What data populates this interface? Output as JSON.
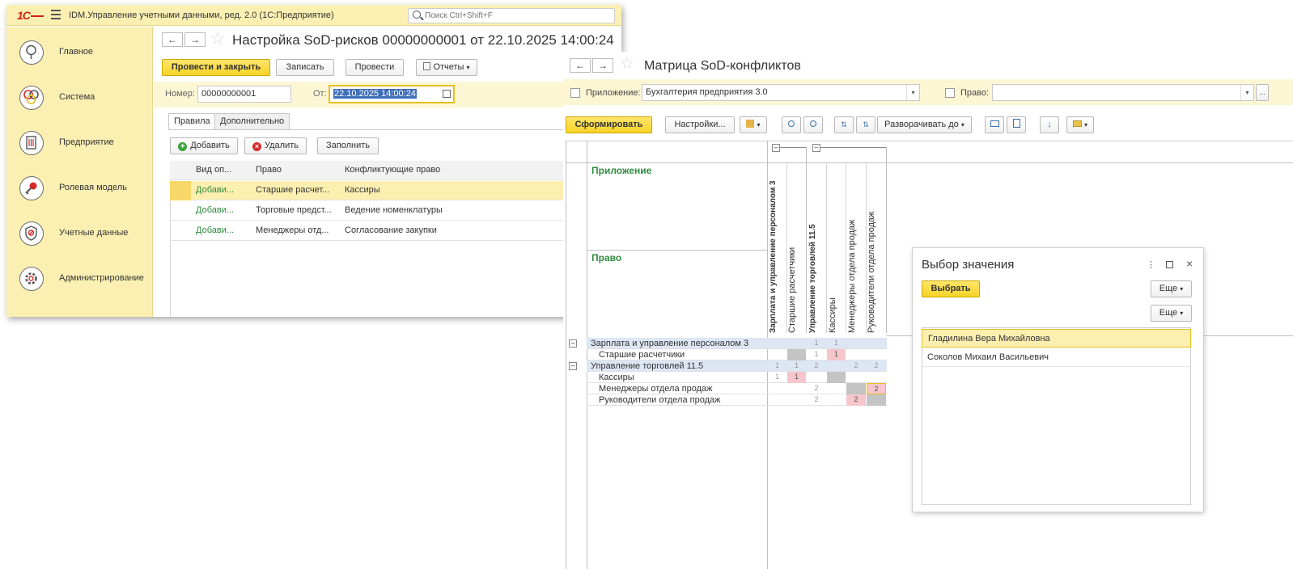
{
  "window1": {
    "app_title": "IDM.Управление учетными данными, ред. 2.0  (1С:Предприятие)",
    "search": {
      "placeholder": "Поиск Ctrl+Shift+F"
    },
    "sidebar": {
      "items": [
        {
          "label": "Главное",
          "icon": "tree-icon"
        },
        {
          "label": "Система",
          "icon": "system-icon"
        },
        {
          "label": "Предприятие",
          "icon": "building-icon"
        },
        {
          "label": "Ролевая модель",
          "icon": "key-icon"
        },
        {
          "label": "Учетные данные",
          "icon": "shield-icon"
        },
        {
          "label": "Администрирование",
          "icon": "gear-icon"
        }
      ]
    },
    "document": {
      "title": "Настройка SoD-рисков 00000000001 от 22.10.2025 14:00:24",
      "toolbar": {
        "post_close": "Провести и закрыть",
        "save": "Записать",
        "post": "Провести",
        "reports": "Отчеты"
      },
      "number_label": "Номер:",
      "number_value": "00000000001",
      "date_label": "От:",
      "date_value": "22.10.2025 14:00:24",
      "tabs": [
        "Правила",
        "Дополнительно"
      ],
      "table_toolbar": {
        "add": "Добавить",
        "delete": "Удалить",
        "fill": "Заполнить"
      },
      "table": {
        "columns": [
          "Вид оп...",
          "Право",
          "Конфликтующие право"
        ],
        "rows": [
          {
            "op": "Добави...",
            "right": "Старшие расчет...",
            "conflict": "Кассиры"
          },
          {
            "op": "Добави...",
            "right": "Торговые предст...",
            "conflict": "Ведение номенклатуры"
          },
          {
            "op": "Добави...",
            "right": "Менеджеры отд...",
            "conflict": "Согласование закупки"
          }
        ]
      }
    }
  },
  "window2": {
    "title": "Матрица SoD-конфликтов",
    "filter": {
      "app_label": "Приложение:",
      "app_value": "Бухгалтерия предприятия 3.0",
      "right_label": "Право:",
      "right_value": ""
    },
    "toolbar": {
      "generate": "Сформировать",
      "settings": "Настройки...",
      "expand_to": "Разворачивать до"
    },
    "matrix": {
      "corner_app": "Приложение",
      "corner_right": "Право",
      "columns": [
        "Зарплата и управление персоналом 3",
        "Старшие расчетчики",
        "Управление торговлей 11.5",
        "Кассиры",
        "Менеджеры отдела продаж",
        "Руководители отдела продаж"
      ],
      "rows": [
        {
          "label": "Зарплата и управление персоналом 3",
          "cells": [
            "",
            "",
            "1",
            "1",
            "",
            ""
          ]
        },
        {
          "label": "Старшие расчетчики",
          "cells": [
            "",
            "",
            "1",
            "1",
            "",
            ""
          ]
        },
        {
          "label": "Управление торговлей 11.5",
          "cells": [
            "1",
            "1",
            "2",
            "",
            "2",
            "2"
          ]
        },
        {
          "label": "Кассиры",
          "cells": [
            "1",
            "1",
            "",
            "",
            "",
            ""
          ]
        },
        {
          "label": "Менеджеры отдела продаж",
          "cells": [
            "",
            "",
            "2",
            "",
            "",
            "2"
          ]
        },
        {
          "label": "Руководители отдела продаж",
          "cells": [
            "",
            "",
            "2",
            "",
            "2",
            ""
          ]
        }
      ]
    }
  },
  "dialog": {
    "title": "Выбор значения",
    "select_button": "Выбрать",
    "more_button": "Еще",
    "items": [
      "Гладилина Вера Михайловна",
      "Соколов Михаил Васильевич"
    ]
  },
  "colors": {
    "accent_yellow": "#f7d428",
    "panel_yellow": "#fbf0b2",
    "group_green": "#2e8b3e",
    "conflict_pink": "#f6c6cc",
    "diagonal_gray": "#c4c4c4"
  }
}
